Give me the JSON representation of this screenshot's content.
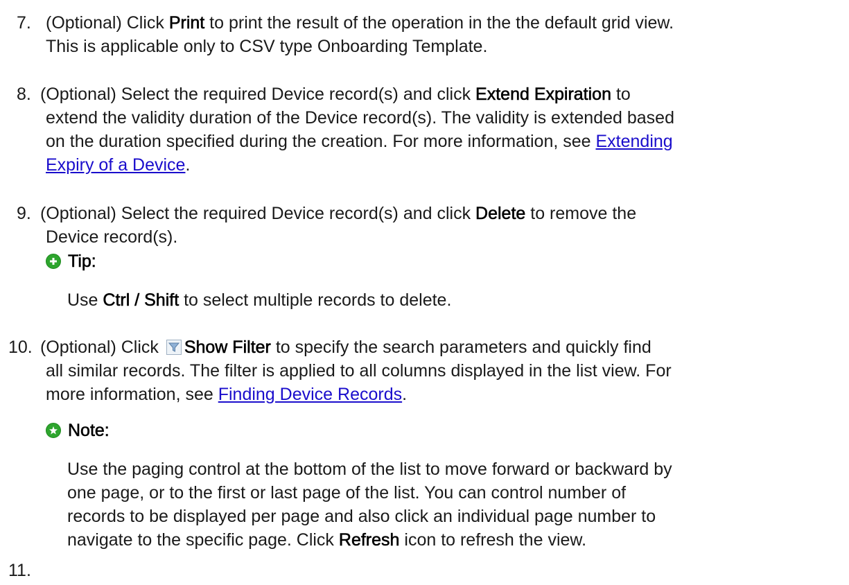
{
  "steps": {
    "s7": {
      "number": "7.",
      "line1_pre": "(Optional) Click ",
      "line1_bold": "Print",
      "line1_post": " to print the result of the operation in the the default grid view.",
      "line2": "This is applicable only to CSV type Onboarding Template."
    },
    "s8": {
      "number": "8.",
      "line1_pre": " (Optional) Select the required Device record(s) and click ",
      "line1_bold": "Extend Expiration",
      "line1_post": " to",
      "line2": "extend the validity duration of the Device record(s). The validity is extended based",
      "line3_pre": "on the duration specified during the creation. For more information, see ",
      "link_part1": "Extending",
      "link_part2": "Expiry of a Device",
      "line4_post": "."
    },
    "s9": {
      "number": "9.",
      "line1_pre": " (Optional) Select the required Device record(s) and click ",
      "line1_bold": "Delete",
      "line1_post": " to remove the",
      "line2": "Device record(s).",
      "tip_title": "Tip:",
      "tip_pre": "Use ",
      "tip_bold": "Ctrl / Shift",
      "tip_post": " to select multiple records to delete."
    },
    "s10": {
      "number": "10.",
      "line1_pre": " (Optional) Click ",
      "line1_bold": "Show Filter",
      "line1_post": " to specify the search parameters and quickly find",
      "line2": "all similar records. The filter is applied to all columns displayed in the list view. For",
      "line3_pre": "more information, see ",
      "link": "Finding Device Records",
      "line3_post": ".",
      "icon": "filter-icon"
    },
    "note": {
      "title": "Note:",
      "line1": "Use the paging control at the bottom of the list to move forward or backward by",
      "line2": "one page, or to the first or last page of the list. You can control number of",
      "line3": "records to be displayed per page and also click an individual page number to",
      "line4_pre": "navigate to the specific page. Click ",
      "line4_bold": "Refresh",
      "line4_post": " icon to refresh the view."
    },
    "s11": {
      "number": "11."
    }
  },
  "colors": {
    "link": "#1a0dcc",
    "tip_icon": "#2ea52e",
    "note_icon": "#2ea52e"
  }
}
